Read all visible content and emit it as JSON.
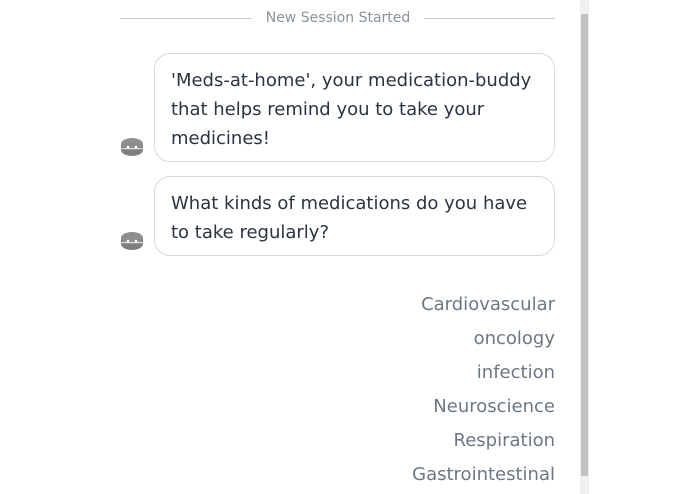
{
  "session": {
    "label": "New Session Started"
  },
  "messages": [
    {
      "sender": "bot",
      "text": "'Meds-at-home', your medication-buddy that helps remind you to take your medicines!"
    },
    {
      "sender": "bot",
      "text": "What kinds of medications do you have to take regularly?"
    }
  ],
  "quick_replies": [
    "Cardiovascular",
    "oncology",
    "infection",
    "Neuroscience",
    "Respiration",
    "Gastrointestinal"
  ],
  "icons": {
    "bot_avatar": "pill-bot-icon"
  },
  "colors": {
    "text": "#2a3442",
    "muted": "#8a929b",
    "option": "#6b7785",
    "border": "#d6d9dc"
  }
}
